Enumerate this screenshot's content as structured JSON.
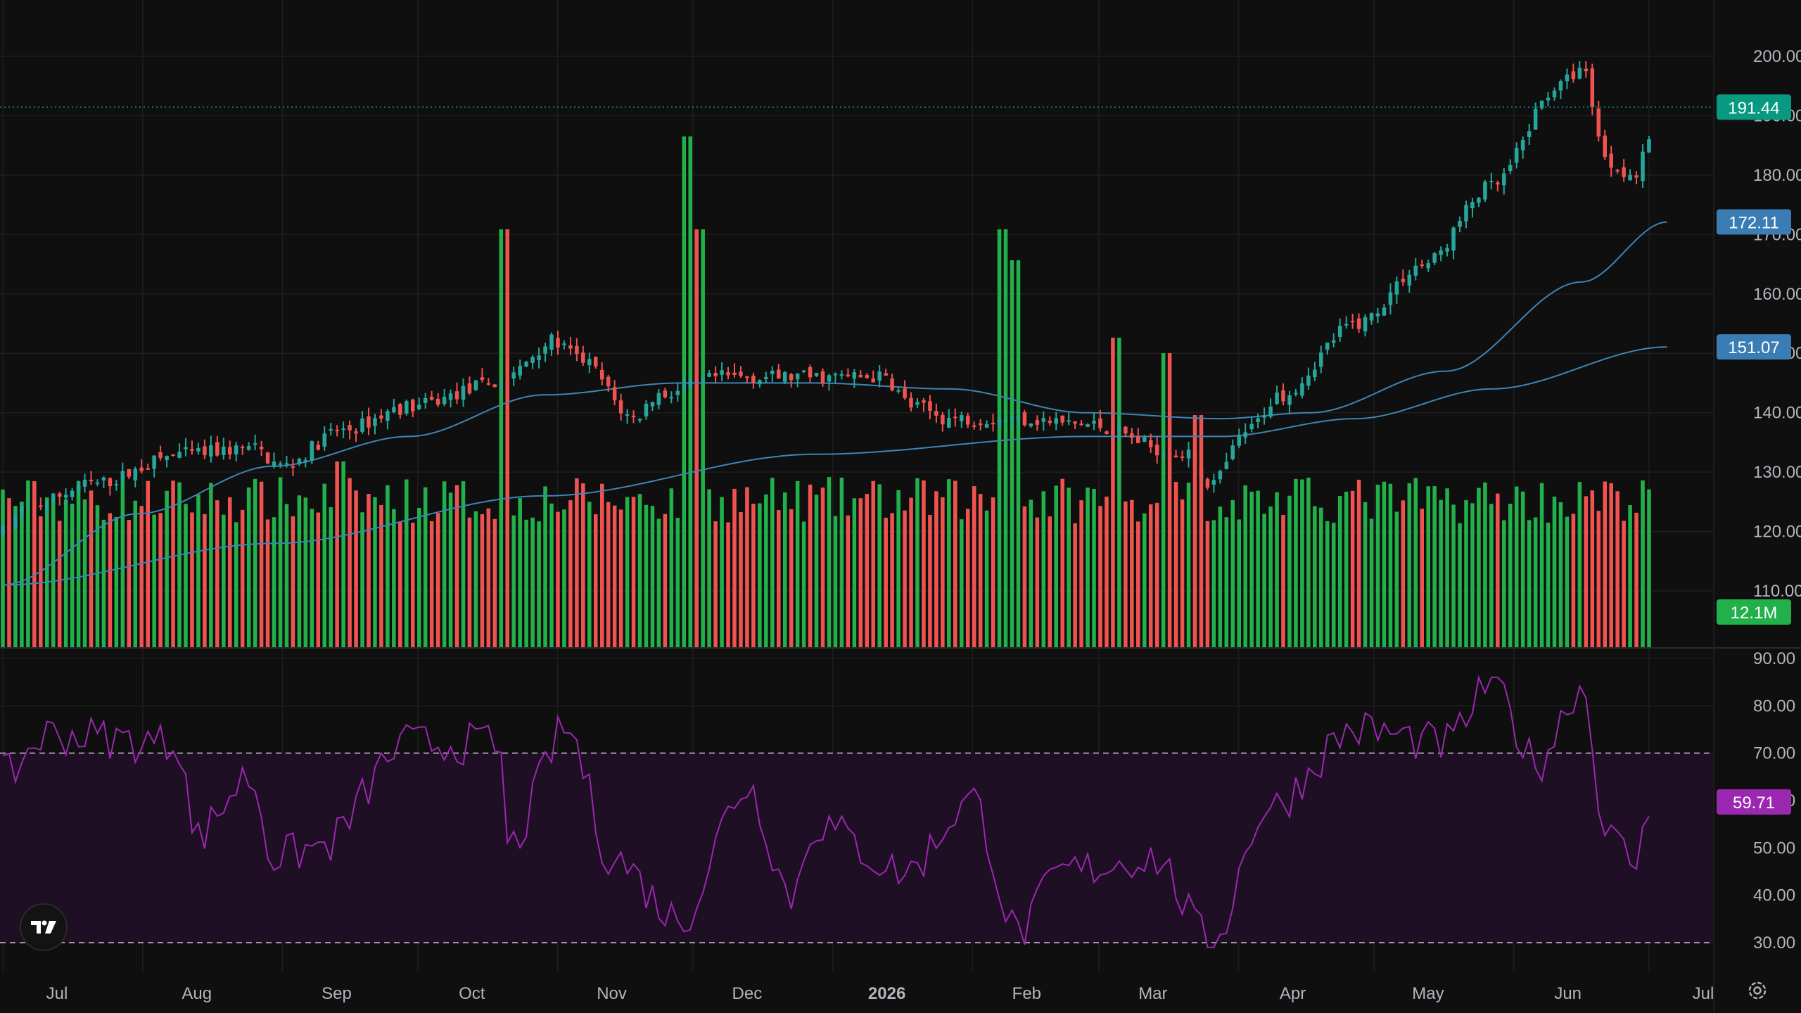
{
  "chart_data": {
    "type": "candlestick",
    "price_axis": {
      "ticks": [
        30,
        40,
        50,
        60,
        70,
        80,
        90
      ],
      "price_ticks": [
        "200.00",
        "190.00",
        "180.00",
        "170.00",
        "160.00",
        "150.00",
        "140.00",
        "130.00",
        "120.00",
        "110.00"
      ],
      "price_tick_values": [
        200,
        190,
        180,
        170,
        160,
        150,
        140,
        130,
        120,
        110
      ],
      "rsi_ticks": [
        "90.00",
        "80.00",
        "70.00",
        "60.00",
        "50.00",
        "40.00",
        "30.00"
      ],
      "rsi_tick_values": [
        90,
        80,
        70,
        60,
        50,
        40,
        30
      ]
    },
    "time_axis": {
      "labels": [
        "Jul",
        "Aug",
        "Sep",
        "Oct",
        "Nov",
        "Dec",
        "2026",
        "Feb",
        "Mar",
        "Apr",
        "May",
        "Jun",
        "Jul"
      ],
      "bold_label": "2026",
      "month_day_offsets": [
        0,
        31,
        62,
        92,
        123,
        153,
        184,
        215,
        243,
        274,
        304,
        335,
        365
      ]
    },
    "series": {
      "price_knots": [
        [
          0,
          120
        ],
        [
          5,
          124
        ],
        [
          20,
          128
        ],
        [
          40,
          133
        ],
        [
          55,
          134
        ],
        [
          62,
          131
        ],
        [
          75,
          137
        ],
        [
          90,
          141
        ],
        [
          110,
          145
        ],
        [
          122,
          152
        ],
        [
          128,
          149
        ],
        [
          140,
          139
        ],
        [
          145,
          143
        ],
        [
          160,
          146
        ],
        [
          175,
          146
        ],
        [
          195,
          146
        ],
        [
          202,
          141
        ],
        [
          210,
          139
        ],
        [
          225,
          139
        ],
        [
          240,
          138
        ],
        [
          262,
          133
        ],
        [
          268,
          128
        ],
        [
          276,
          137
        ],
        [
          283,
          143
        ],
        [
          300,
          155
        ],
        [
          315,
          165
        ],
        [
          330,
          178
        ],
        [
          345,
          195
        ],
        [
          350,
          198
        ],
        [
          356,
          182
        ],
        [
          362,
          180
        ],
        [
          366,
          188
        ],
        [
          369,
          191.44
        ]
      ],
      "ma_50_knots": [
        [
          0,
          111
        ],
        [
          30,
          123
        ],
        [
          60,
          131
        ],
        [
          90,
          136
        ],
        [
          120,
          143
        ],
        [
          150,
          145
        ],
        [
          180,
          145
        ],
        [
          210,
          144
        ],
        [
          240,
          140
        ],
        [
          270,
          139
        ],
        [
          290,
          140
        ],
        [
          320,
          147
        ],
        [
          350,
          162
        ],
        [
          369,
          172.11
        ]
      ],
      "ma_200_knots": [
        [
          0,
          111
        ],
        [
          60,
          118
        ],
        [
          120,
          126
        ],
        [
          180,
          133
        ],
        [
          240,
          136
        ],
        [
          270,
          136
        ],
        [
          300,
          139
        ],
        [
          330,
          144
        ],
        [
          369,
          151.07
        ]
      ],
      "rsi_knots": [
        [
          0,
          65
        ],
        [
          10,
          74
        ],
        [
          40,
          72
        ],
        [
          42,
          52
        ],
        [
          55,
          65
        ],
        [
          60,
          48
        ],
        [
          70,
          50
        ],
        [
          90,
          72
        ],
        [
          110,
          72
        ],
        [
          112,
          50
        ],
        [
          125,
          75
        ],
        [
          135,
          48
        ],
        [
          150,
          35
        ],
        [
          165,
          63
        ],
        [
          175,
          40
        ],
        [
          180,
          55
        ],
        [
          200,
          45
        ],
        [
          215,
          60
        ],
        [
          225,
          32
        ],
        [
          235,
          45
        ],
        [
          255,
          48
        ],
        [
          268,
          30
        ],
        [
          280,
          58
        ],
        [
          300,
          75
        ],
        [
          320,
          72
        ],
        [
          330,
          85
        ],
        [
          340,
          68
        ],
        [
          350,
          84
        ],
        [
          356,
          52
        ],
        [
          362,
          47
        ],
        [
          366,
          60
        ],
        [
          369,
          59.71
        ]
      ],
      "volume_base": 8,
      "volume_spikes": [
        [
          75,
          12
        ],
        [
          111,
          27
        ],
        [
          152,
          33
        ],
        [
          154,
          27
        ],
        [
          222,
          27
        ],
        [
          225,
          25
        ],
        [
          247,
          20
        ],
        [
          258,
          19
        ],
        [
          265,
          15
        ]
      ]
    },
    "last_price": 191.44,
    "ma_50_value": 172.11,
    "ma_200_value": 151.07,
    "volume_last": 12.1,
    "rsi_last": 59.71,
    "rsi_upper_band": 70,
    "rsi_lower_band": 30,
    "labels": {
      "last_price": "191.44",
      "ma_50": "172.11",
      "ma_200": "151.07",
      "volume": "12.1M",
      "rsi": "59.71"
    },
    "grid": true,
    "colors": {
      "up": "#26a69a",
      "up_bright": "#22b04a",
      "down": "#ef5350",
      "ma": "#3f84b4",
      "ma_badge": "#3a7db5",
      "price_badge": "#089981",
      "rsi_line": "#9c27b0",
      "rsi_badge": "#9c27b0",
      "rsi_band_fill": "#1e0f24",
      "grid": "#1e1e1e",
      "background": "#0f0f0f"
    }
  },
  "icons": {
    "logo": "tradingview-logo",
    "settings": "gear-icon"
  }
}
